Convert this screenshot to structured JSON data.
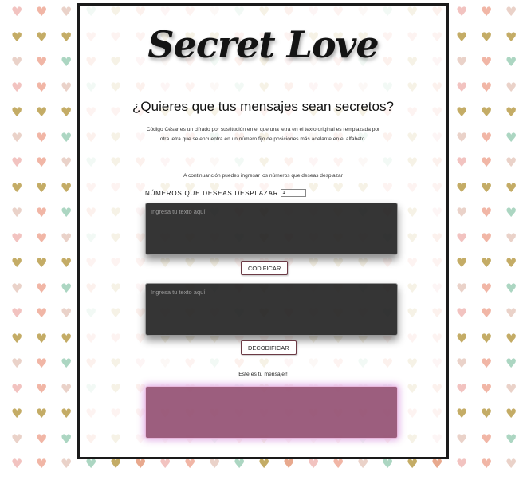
{
  "background": {
    "heart_glyph": "♥",
    "colors": [
      "#f2c3c0",
      "#e8a98e",
      "#c4ac66",
      "#acd6c2",
      "#ead2c9",
      "#f1b6a6"
    ]
  },
  "header": {
    "title": "Secret Love"
  },
  "main": {
    "headline": "¿Quieres que tus mensajes sean secretos?",
    "description": "Código César es un cifrado por sustitución en el que una letra en el texto original es remplazada por otra letra que se encuentra en un número fijo de posiciones más adelante en el alfabeto.",
    "instruction": "A continuanción puedes ingresar los números que deseas desplazar",
    "shift": {
      "label": "NÚMEROS QUE DESEAS DESPLAZAR",
      "value": "1"
    },
    "encode_input": {
      "placeholder": "Ingresa tu texto aquí",
      "value": ""
    },
    "encode_button": "CODIFICAR",
    "decode_input": {
      "placeholder": "Ingresa tu texto aquí",
      "value": ""
    },
    "decode_button": "DECODIFICAR",
    "result_label": "Este es tu mensaje!!",
    "result_output": {
      "value": ""
    }
  }
}
